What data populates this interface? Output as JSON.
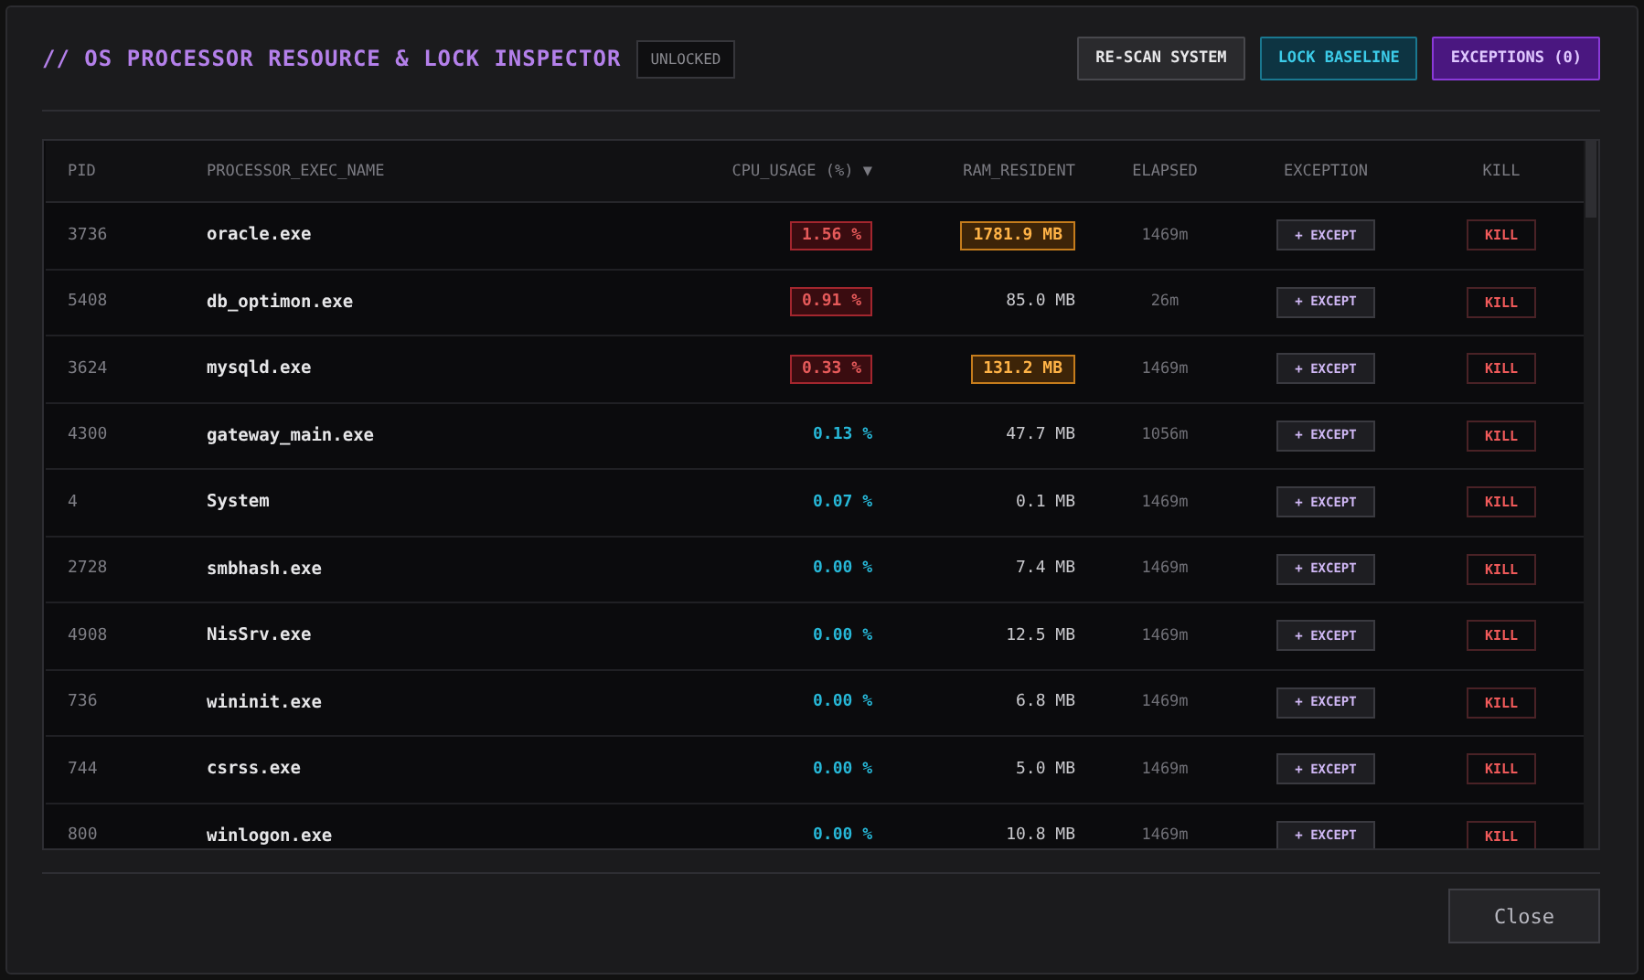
{
  "header": {
    "title": "// OS PROCESSOR RESOURCE & LOCK INSPECTOR",
    "lock_badge": "UNLOCKED",
    "buttons": [
      {
        "kind": "neutral",
        "label": "RE-SCAN SYSTEM"
      },
      {
        "kind": "cyan",
        "label": "LOCK BASELINE"
      },
      {
        "kind": "purple",
        "label": "EXCEPTIONS (0)"
      }
    ]
  },
  "table": {
    "columns": [
      "PID",
      "PROCESSOR_EXEC_NAME",
      "CPU_USAGE (%) ▼",
      "RAM_RESIDENT",
      "ELAPSED",
      "EXCEPTION",
      "KILL"
    ],
    "rows": [
      {
        "pid": "3736",
        "name": "oracle.exe",
        "cpu": "1.56 %",
        "cpu_alert": true,
        "ram": "1781.9 MB",
        "ram_alert": true,
        "elapsed": "1469m",
        "exception": "+ EXCEPT",
        "kill": "KILL"
      },
      {
        "pid": "5408",
        "name": "db_optimon.exe",
        "cpu": "0.91 %",
        "cpu_alert": true,
        "ram": "85.0 MB",
        "ram_alert": false,
        "elapsed": "26m",
        "exception": "+ EXCEPT",
        "kill": "KILL"
      },
      {
        "pid": "3624",
        "name": "mysqld.exe",
        "cpu": "0.33 %",
        "cpu_alert": true,
        "ram": "131.2 MB",
        "ram_alert": true,
        "elapsed": "1469m",
        "exception": "+ EXCEPT",
        "kill": "KILL"
      },
      {
        "pid": "4300",
        "name": "gateway_main.exe",
        "cpu": "0.13 %",
        "cpu_alert": false,
        "ram": "47.7 MB",
        "ram_alert": false,
        "elapsed": "1056m",
        "exception": "+ EXCEPT",
        "kill": "KILL"
      },
      {
        "pid": "4",
        "name": "System",
        "cpu": "0.07 %",
        "cpu_alert": false,
        "ram": "0.1 MB",
        "ram_alert": false,
        "elapsed": "1469m",
        "exception": "+ EXCEPT",
        "kill": "KILL"
      },
      {
        "pid": "2728",
        "name": "smbhash.exe",
        "cpu": "0.00 %",
        "cpu_alert": false,
        "ram": "7.4 MB",
        "ram_alert": false,
        "elapsed": "1469m",
        "exception": "+ EXCEPT",
        "kill": "KILL"
      },
      {
        "pid": "4908",
        "name": "NisSrv.exe",
        "cpu": "0.00 %",
        "cpu_alert": false,
        "ram": "12.5 MB",
        "ram_alert": false,
        "elapsed": "1469m",
        "exception": "+ EXCEPT",
        "kill": "KILL"
      },
      {
        "pid": "736",
        "name": "wininit.exe",
        "cpu": "0.00 %",
        "cpu_alert": false,
        "ram": "6.8 MB",
        "ram_alert": false,
        "elapsed": "1469m",
        "exception": "+ EXCEPT",
        "kill": "KILL"
      },
      {
        "pid": "744",
        "name": "csrss.exe",
        "cpu": "0.00 %",
        "cpu_alert": false,
        "ram": "5.0 MB",
        "ram_alert": false,
        "elapsed": "1469m",
        "exception": "+ EXCEPT",
        "kill": "KILL"
      },
      {
        "pid": "800",
        "name": "winlogon.exe",
        "cpu": "0.00 %",
        "cpu_alert": false,
        "ram": "10.8 MB",
        "ram_alert": false,
        "elapsed": "1469m",
        "exception": "+ EXCEPT",
        "kill": "KILL"
      }
    ]
  },
  "footer": {
    "close_button": "Close"
  }
}
